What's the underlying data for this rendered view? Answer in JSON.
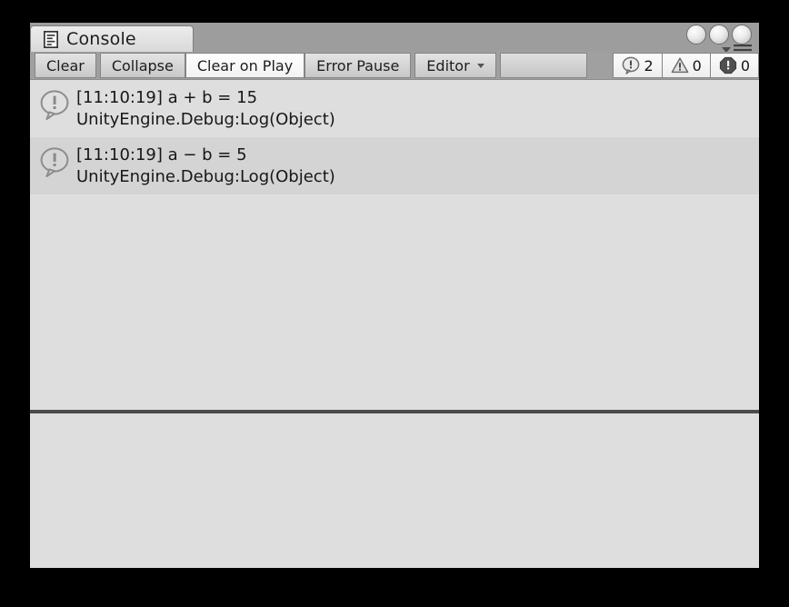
{
  "window": {
    "tab": {
      "label": "Console",
      "icon": "console-document-icon"
    },
    "controls": {
      "button_1": "window-dot-1",
      "button_2": "window-dot-2",
      "button_3": "window-dot-3",
      "menu": "hamburger-menu-icon"
    }
  },
  "toolbar": {
    "clear_label": "Clear",
    "collapse_label": "Collapse",
    "clear_on_play_label": "Clear on Play",
    "error_pause_label": "Error Pause",
    "editor_label": "Editor",
    "editor_dropdown_icon": "chevron-down-icon",
    "counters": [
      {
        "icon": "info-bubble-icon",
        "count": "2"
      },
      {
        "icon": "warning-triangle-icon",
        "count": "0"
      },
      {
        "icon": "error-octagon-icon",
        "count": "0"
      }
    ]
  },
  "log": {
    "entries": [
      {
        "icon": "info-bubble-icon",
        "message": "[11:10:19] a + b = 15",
        "stacktrace": "UnityEngine.Debug:Log(Object)"
      },
      {
        "icon": "info-bubble-icon",
        "message": "[11:10:19] a − b = 5",
        "stacktrace": "UnityEngine.Debug:Log(Object)"
      }
    ]
  },
  "detail": {
    "content": ""
  },
  "colors": {
    "window_bg": "#dedede",
    "header_bg": "#9d9d9d",
    "toolbar_bg": "#a0a0a0",
    "row_even": "#dedede",
    "row_odd": "#d4d4d4",
    "splitter": "#4b4b4b",
    "text": "#171717",
    "error_icon": "#4d4d4d"
  }
}
